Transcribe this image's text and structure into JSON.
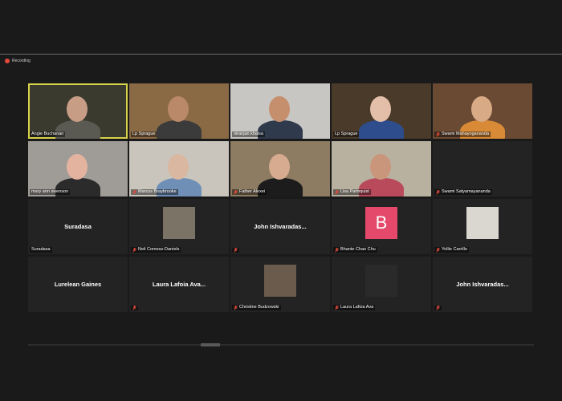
{
  "recording": {
    "label": "Recording"
  },
  "participants": [
    {
      "name": "Angie Buchanan",
      "mic": false,
      "active": true,
      "kind": "video",
      "bg": "#3b3a2f",
      "skin": "#c79d86",
      "shirt": "#5b5a52"
    },
    {
      "name": "Lp Sprague",
      "mic": false,
      "kind": "video",
      "bg": "#8a6a45",
      "skin": "#b9896a",
      "shirt": "#3b3b3b"
    },
    {
      "name": "niranjan khalsa",
      "mic": false,
      "kind": "video",
      "bg": "#c8c6c2",
      "skin": "#c58f6e",
      "shirt": "#2f3a4c"
    },
    {
      "name": "Lp Sprague",
      "mic": false,
      "kind": "video",
      "bg": "#4a3a2a",
      "skin": "#e3bfa9",
      "shirt": "#2e4d8c"
    },
    {
      "name": "Swami Mahayogananda",
      "mic": true,
      "kind": "video",
      "bg": "#6a4a33",
      "skin": "#d8aa86",
      "shirt": "#d98a36"
    },
    {
      "name": "mary ann swenson",
      "mic": false,
      "kind": "video",
      "bg": "#9f9c97",
      "skin": "#e3b3a0",
      "shirt": "#2b2b2b"
    },
    {
      "name": "Marcus Braybrooke",
      "mic": true,
      "kind": "video",
      "bg": "#c9c5bc",
      "skin": "#d9b7a0",
      "shirt": "#6f8fb7"
    },
    {
      "name": "Father Alexei",
      "mic": true,
      "kind": "video",
      "bg": "#8d7b62",
      "skin": "#d6ab90",
      "shirt": "#1c1c1c"
    },
    {
      "name": "Lisa Palmquist",
      "mic": true,
      "kind": "video",
      "bg": "#b9b1a0",
      "skin": "#c9967c",
      "shirt": "#b94a5c"
    },
    {
      "name": "Swami Satyamayananda",
      "mic": true,
      "kind": "blank"
    },
    {
      "name": "Suradasa",
      "mic": false,
      "kind": "name-only",
      "display": "Suradasa"
    },
    {
      "name": "Neil Comess-Daniels",
      "mic": true,
      "kind": "thumb",
      "thumb_bg": "#7b7365"
    },
    {
      "name": "",
      "mic": true,
      "kind": "name-only",
      "display": "John Ishvaradas..."
    },
    {
      "name": "Bhante Chao Chu",
      "mic": true,
      "kind": "avatar",
      "letter": "B"
    },
    {
      "name": "Yollie Carrillo",
      "mic": true,
      "kind": "thumb",
      "thumb_bg": "#d9d7d0"
    },
    {
      "name": "",
      "mic": false,
      "kind": "name-only",
      "display": "Lurelean Gaines"
    },
    {
      "name": "",
      "mic": true,
      "kind": "name-only",
      "display": "Laura Lafoia Ava..."
    },
    {
      "name": "Christine Budzowski",
      "mic": true,
      "kind": "thumb",
      "thumb_bg": "#6b5b4d"
    },
    {
      "name": "Laura Lafoia Ava",
      "mic": true,
      "kind": "thumb",
      "thumb_bg": "#2a2a2a"
    },
    {
      "name": "",
      "mic": true,
      "kind": "name-only",
      "display": "John Ishvaradas..."
    }
  ],
  "colors": {
    "mic_muted": "#e24b3b",
    "active_border": "#d6d24a",
    "avatar_b": "#e4486a"
  },
  "icons": {
    "mic": "mic-muted-icon",
    "recording": "record-dot-icon"
  }
}
